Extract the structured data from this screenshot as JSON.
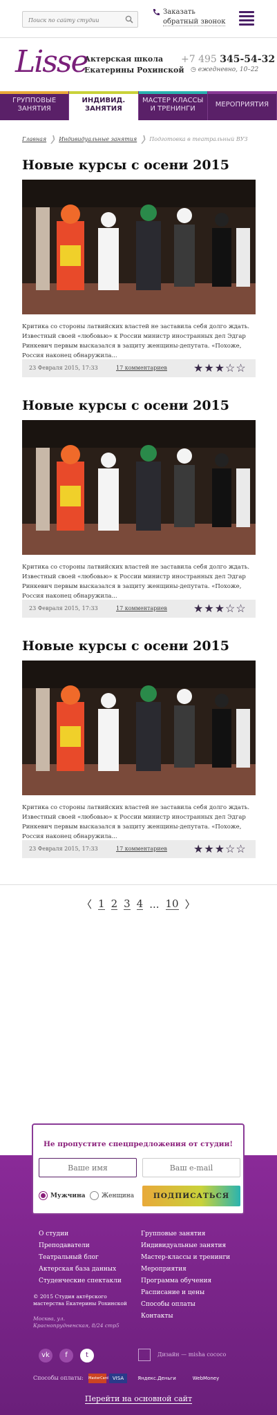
{
  "header": {
    "search_placeholder": "Поиск по сайту студии",
    "callback_line1": "Заказать",
    "callback_line2": "обратный звонок"
  },
  "brand": {
    "logo_text": "Lisse",
    "school_line1": "Актерская школа",
    "school_line2": "Екатерины Рохинской",
    "phone_code": "+7 495",
    "phone_number": "345-54-32",
    "hours": "ежедневно, 10–22"
  },
  "nav": {
    "items": [
      {
        "line1": "Групповые",
        "line2": "занятия",
        "color": "#e8a93a"
      },
      {
        "line1": "Индивид.",
        "line2": "занятия",
        "color": "#c9d23a"
      },
      {
        "line1": "Мастер классы",
        "line2": "и тренинги",
        "color": "#2ab3b0"
      },
      {
        "line1": "Мероприятия",
        "line2": "",
        "color": "#8a3a96"
      }
    ]
  },
  "breadcrumb": {
    "items": [
      "Главная",
      "Индивидуальные занятия",
      "Подготовка в театральный ВУЗ"
    ]
  },
  "articles": [
    {
      "title": "Новые курсы с осени 2015",
      "excerpt": "Критика со стороны латвийских властей не заставила себя долго ждать. Известный своей «любовью» к России министр иностранных дел Эдгар Ринкевич первым высказался в защиту женщины-депутата. «Похоже, Россия наконец обнаружила...",
      "date": "23 Февраля 2015, 17:33",
      "comments": "17 комментариев",
      "rating": 3,
      "max_rating": 5
    },
    {
      "title": "Новые курсы с осени 2015",
      "excerpt": "Критика со стороны латвийских властей не заставила себя долго ждать. Известный своей «любовью» к России министр иностранных дел Эдгар Ринкевич первым высказался в защиту женщины-депутата. «Похоже, Россия наконец обнаружила...",
      "date": "23 Февраля 2015, 17:33",
      "comments": "17 комментариев",
      "rating": 3,
      "max_rating": 5
    },
    {
      "title": "Новые курсы с осени 2015",
      "excerpt": "Критика со стороны латвийских властей не заставила себя долго ждать. Известный своей «любовью» к России министр иностранных дел Эдгар Ринкевич первым высказался в защиту женщины-депутата. «Похоже, Россия наконец обнаружила...",
      "date": "23 Февраля 2015, 17:33",
      "comments": "17 комментариев",
      "rating": 3,
      "max_rating": 5
    }
  ],
  "pager": {
    "prev": "〈",
    "pages": [
      "1",
      "2",
      "3",
      "4"
    ],
    "ellipsis": "...",
    "last": "10",
    "next": "〉"
  },
  "subscribe": {
    "title": "Не пропустите спецпредложения от студии!",
    "name_placeholder": "Ваше имя",
    "email_placeholder": "Ваш e-mail",
    "gender_male": "Мужчина",
    "gender_female": "Женщина",
    "selected_gender": "male",
    "button": "ПОДПИСАТЬСЯ"
  },
  "footer": {
    "links_left": [
      "О студии",
      "Преподаватели",
      "Театральный блог",
      "Актерская база данных",
      "Студенческие спектакли"
    ],
    "links_right": [
      "Групповые занятия",
      "Индивидуальные занятия",
      "Мастер-классы и тренинги",
      "Мероприятия",
      "Программа обучения",
      "Расписание и цены",
      "Способы оплаты",
      "Контакты"
    ],
    "copyright": "© 2015 Студия актёрского мастерства Екатерины Рохинской",
    "address": "Москва, ул. Краснопрудненская, 8/24 стр5",
    "social": [
      "vk",
      "f",
      "twitter"
    ],
    "design": "Дизайн — misha cococo",
    "payment_label": "Способы оплаты:",
    "payment_methods": [
      "MasterCard",
      "VISA",
      "Яндекс.Деньги",
      "WebMoney"
    ],
    "main_site": "Перейти на основной сайт"
  }
}
